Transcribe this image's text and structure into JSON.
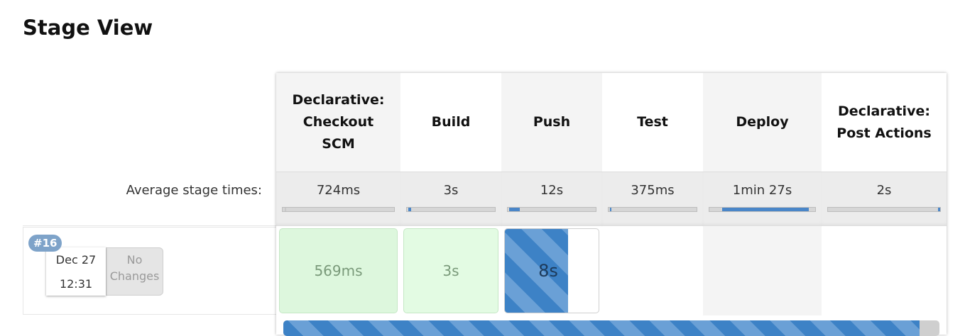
{
  "page": {
    "title": "Stage View"
  },
  "average_label": "Average stage times:",
  "build": {
    "number": "#16",
    "date": "Dec 27",
    "time": "12:31",
    "changes_line1": "No",
    "changes_line2": "Changes"
  },
  "stages": [
    {
      "name_lines": [
        "Declarative:",
        "Checkout",
        "SCM"
      ],
      "avg": "724ms",
      "avg_fraction": 0.01,
      "status": "success",
      "duration": "569ms"
    },
    {
      "name_lines": [
        "Build"
      ],
      "avg": "3s",
      "avg_fraction": 0.03,
      "status": "success",
      "duration": "3s"
    },
    {
      "name_lines": [
        "Push"
      ],
      "avg": "12s",
      "avg_fraction": 0.12,
      "status": "running",
      "duration": "8s"
    },
    {
      "name_lines": [
        "Test"
      ],
      "avg": "375ms",
      "avg_fraction": 0.01,
      "status": "empty",
      "duration": ""
    },
    {
      "name_lines": [
        "Deploy"
      ],
      "avg": "1min 27s",
      "avg_fraction": 0.82,
      "status": "empty",
      "duration": ""
    },
    {
      "name_lines": [
        "Declarative:",
        "Post Actions"
      ],
      "avg": "2s",
      "avg_fraction": 0.02,
      "status": "empty",
      "duration": ""
    }
  ],
  "overall_progress": 0.97,
  "colors": {
    "success_bg": "#ddf7dd",
    "running": "#3d82c6",
    "badge": "#7ea3c9"
  }
}
